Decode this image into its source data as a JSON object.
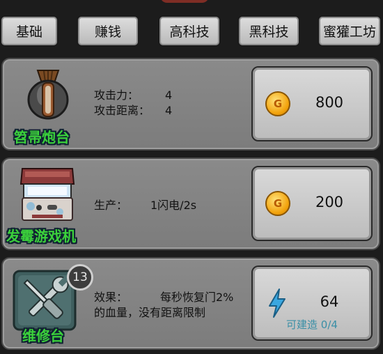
{
  "tabs": [
    {
      "label": "基础"
    },
    {
      "label": "赚钱"
    },
    {
      "label": "高科技"
    },
    {
      "label": "黑科技"
    },
    {
      "label": "蜜獾工坊"
    }
  ],
  "items": [
    {
      "name": "笤帚炮台",
      "stat1_label": "攻击力：",
      "stat1_value": "4",
      "stat2_label": "攻击距离：",
      "stat2_value": "4",
      "price": "800",
      "currency_icon": "gold-coin-icon",
      "coin_letter": "G"
    },
    {
      "name": "发霉游戏机",
      "stat1_label": "生产：",
      "stat1_value": "1闪电/2s",
      "price": "200",
      "currency_icon": "gold-coin-icon",
      "coin_letter": "G"
    },
    {
      "name": "维修台",
      "badge": "13",
      "effect_label": "效果：",
      "effect_line1": "每秒恢复门2%",
      "effect_line2": "的血量，没有距离限制",
      "price": "64",
      "currency_icon": "lightning-icon",
      "build_status": "可建造 0/4"
    }
  ],
  "colors": {
    "item_name": "#3bd13b",
    "lightning": "#3aa7e0",
    "build_status": "#3a8fa6",
    "gold": "#f2a20c"
  }
}
